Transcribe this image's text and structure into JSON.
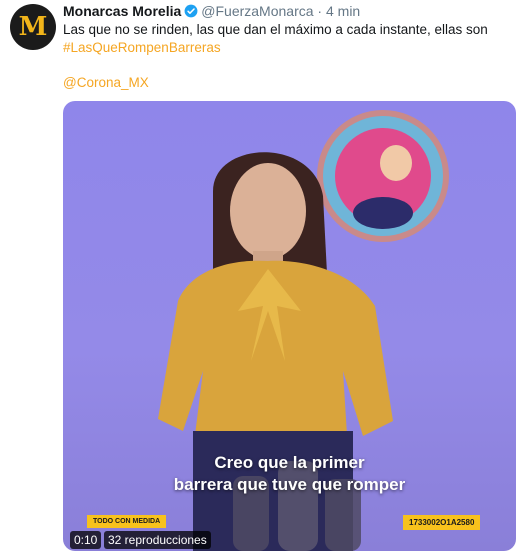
{
  "tweet": {
    "author_name": "Monarcas Morelia",
    "handle": "@FuerzaMonarca",
    "separator": "·",
    "time": "4 min",
    "text": "Las que no se rinden, las que dan el máximo a cada instante, ellas son",
    "hashtag": "#LasQueRompenBarreras",
    "mention": "@Corona_MX",
    "avatar_letter": "M",
    "verified_icon": "verified-badge-icon",
    "link_color": "#f5a623",
    "verified_color": "#1da1f2"
  },
  "media": {
    "caption_line1": "Creo que la primer",
    "caption_line2": "barrera que tuve que romper",
    "tag_left": "TODO CON MEDIDA",
    "tag_right": "1733002O1A2580",
    "duration": "0:10",
    "views": "32 reproducciones",
    "background_color": "#8f86ea",
    "tag_color": "#f8c21c"
  }
}
